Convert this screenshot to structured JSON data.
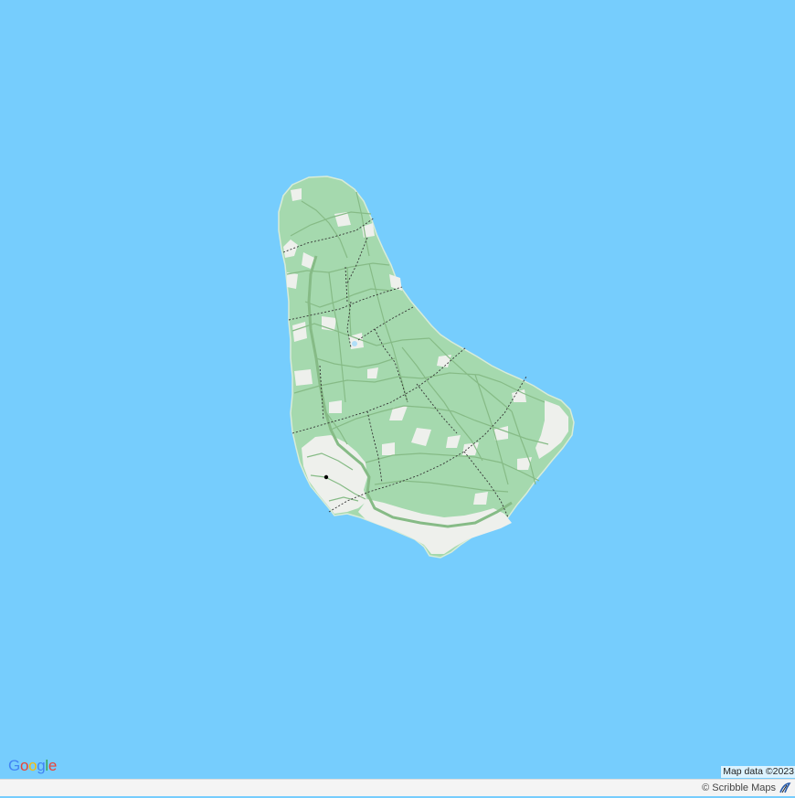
{
  "map": {
    "water_color": "#76cdfd",
    "land_color": "#a5d9ae",
    "urban_color": "#eef0ec",
    "road_color": "#86bb86",
    "boundary_color": "#333333"
  },
  "branding": {
    "logo_letters": [
      "G",
      "o",
      "o",
      "g",
      "l",
      "e"
    ],
    "logo_colors": [
      "#4285f4",
      "#ea4335",
      "#fbbc05",
      "#4285f4",
      "#34a853",
      "#ea4335"
    ]
  },
  "attribution": {
    "map_data": "Map data ©2023"
  },
  "footer": {
    "credit": "© Scribble Maps",
    "credit_icon": "scribble-maps-logo"
  }
}
